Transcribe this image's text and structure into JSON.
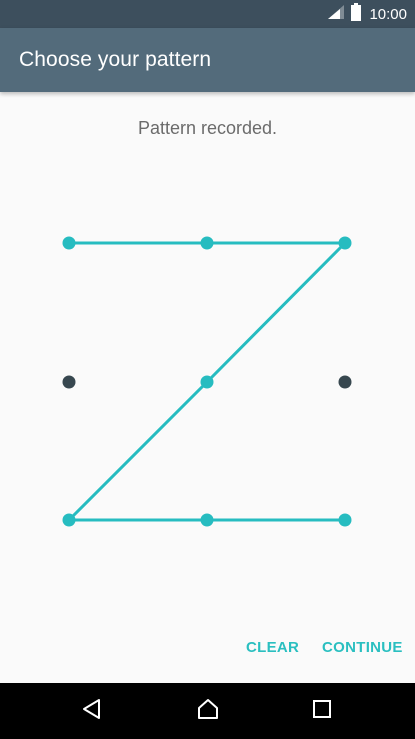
{
  "status_bar": {
    "time": "10:00",
    "signal_icon": "signal-icon",
    "battery_icon": "battery-icon"
  },
  "app_bar": {
    "title": "Choose your pattern"
  },
  "message": "Pattern recorded.",
  "pattern": {
    "grid_size": 3,
    "selected_path": [
      0,
      1,
      2,
      4,
      6,
      7,
      8
    ],
    "accent_color": "#26bcc0",
    "inactive_color": "#37474f"
  },
  "actions": {
    "clear_label": "CLEAR",
    "continue_label": "CONTINUE"
  },
  "nav_bar": {
    "back_icon": "back-icon",
    "home_icon": "home-icon",
    "recents_icon": "recents-icon"
  }
}
